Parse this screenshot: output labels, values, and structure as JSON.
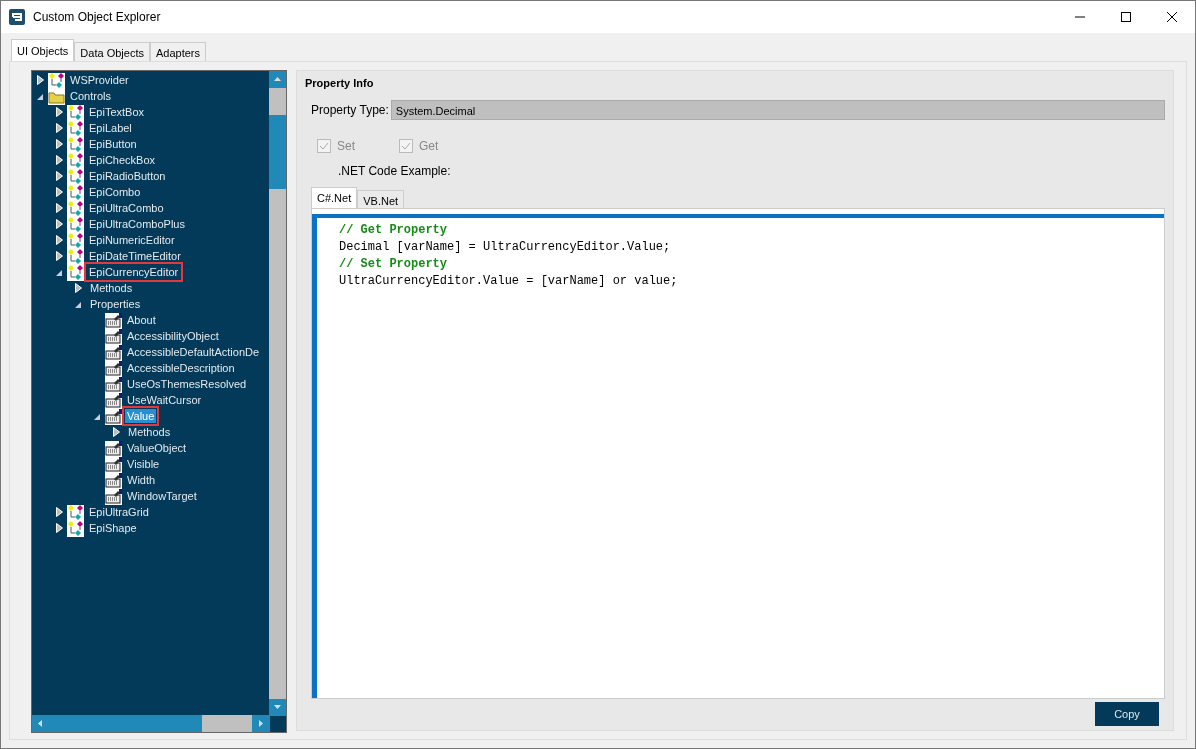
{
  "window": {
    "title": "Custom Object Explorer"
  },
  "tabs": [
    {
      "label": "UI Objects",
      "selected": true
    },
    {
      "label": "Data Objects",
      "selected": false
    },
    {
      "label": "Adapters",
      "selected": false
    }
  ],
  "tree": [
    {
      "label": "WSProvider",
      "kind": "component",
      "expanded": false,
      "selected": false,
      "outlined": false
    },
    {
      "label": "Controls",
      "kind": "folder",
      "expanded": true,
      "selected": false,
      "outlined": false,
      "children": [
        {
          "label": "EpiTextBox",
          "kind": "component",
          "expanded": false,
          "selected": false,
          "outlined": false
        },
        {
          "label": "EpiLabel",
          "kind": "component",
          "expanded": false,
          "selected": false,
          "outlined": false
        },
        {
          "label": "EpiButton",
          "kind": "component",
          "expanded": false,
          "selected": false,
          "outlined": false
        },
        {
          "label": "EpiCheckBox",
          "kind": "component",
          "expanded": false,
          "selected": false,
          "outlined": false
        },
        {
          "label": "EpiRadioButton",
          "kind": "component",
          "expanded": false,
          "selected": false,
          "outlined": false
        },
        {
          "label": "EpiCombo",
          "kind": "component",
          "expanded": false,
          "selected": false,
          "outlined": false
        },
        {
          "label": "EpiUltraCombo",
          "kind": "component",
          "expanded": false,
          "selected": false,
          "outlined": false
        },
        {
          "label": "EpiUltraComboPlus",
          "kind": "component",
          "expanded": false,
          "selected": false,
          "outlined": false
        },
        {
          "label": "EpiNumericEditor",
          "kind": "component",
          "expanded": false,
          "selected": false,
          "outlined": false
        },
        {
          "label": "EpiDateTimeEditor",
          "kind": "component",
          "expanded": false,
          "selected": false,
          "outlined": false
        },
        {
          "label": "EpiCurrencyEditor",
          "kind": "component",
          "expanded": true,
          "selected": false,
          "outlined": true,
          "children": [
            {
              "label": "Methods",
              "expanded": false,
              "selected": false,
              "outlined": false
            },
            {
              "label": "Properties",
              "expanded": true,
              "selected": false,
              "outlined": false,
              "children": [
                {
                  "label": "About",
                  "kind": "property",
                  "selected": false,
                  "outlined": false
                },
                {
                  "label": "AccessibilityObject",
                  "kind": "property",
                  "selected": false,
                  "outlined": false
                },
                {
                  "label": "AccessibleDefaultActionDe",
                  "kind": "property",
                  "selected": false,
                  "outlined": false
                },
                {
                  "label": "AccessibleDescription",
                  "kind": "property",
                  "selected": false,
                  "outlined": false
                },
                {
                  "label": "UseOsThemesResolved",
                  "kind": "property",
                  "selected": false,
                  "outlined": false
                },
                {
                  "label": "UseWaitCursor",
                  "kind": "property",
                  "selected": false,
                  "outlined": false
                },
                {
                  "label": "Value",
                  "kind": "property",
                  "expanded": true,
                  "selected": true,
                  "outlined": true,
                  "children": [
                    {
                      "label": "Methods",
                      "expanded": false,
                      "selected": false,
                      "outlined": false
                    }
                  ]
                },
                {
                  "label": "ValueObject",
                  "kind": "property",
                  "selected": false,
                  "outlined": false
                },
                {
                  "label": "Visible",
                  "kind": "property",
                  "selected": false,
                  "outlined": false
                },
                {
                  "label": "Width",
                  "kind": "property",
                  "selected": false,
                  "outlined": false
                },
                {
                  "label": "WindowTarget",
                  "kind": "property",
                  "selected": false,
                  "outlined": false
                }
              ]
            }
          ]
        },
        {
          "label": "EpiUltraGrid",
          "kind": "component",
          "expanded": false,
          "selected": false,
          "outlined": false
        },
        {
          "label": "EpiShape",
          "kind": "component",
          "expanded": false,
          "selected": false,
          "outlined": false
        }
      ]
    }
  ],
  "property_info": {
    "title": "Property Info",
    "type_label": "Property Type:",
    "type_value": "System.Decimal",
    "checks": [
      {
        "label": "Set",
        "checked": true,
        "disabled": true
      },
      {
        "label": "Get",
        "checked": true,
        "disabled": true
      }
    ],
    "code_label": ".NET Code Example:",
    "code_tabs": [
      {
        "label": "C#.Net",
        "selected": true
      },
      {
        "label": "VB.Net",
        "selected": false
      }
    ],
    "code_lines": [
      {
        "kind": "comment",
        "text": "// Get Property"
      },
      {
        "kind": "code",
        "text": "Decimal [varName] = UltraCurrencyEditor.Value;"
      },
      {
        "kind": "comment",
        "text": "// Set Property"
      },
      {
        "kind": "code",
        "text": "UltraCurrencyEditor.Value = [varName] or value;"
      }
    ],
    "copy_button": "Copy"
  }
}
